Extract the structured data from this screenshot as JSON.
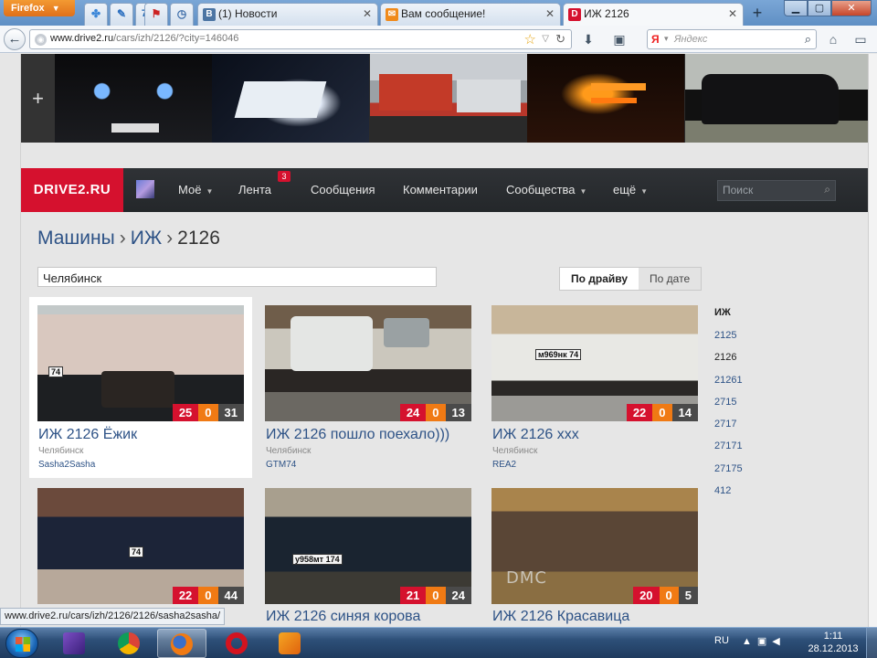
{
  "browser": {
    "app_button": "Firefox",
    "pinned_tabs": [
      {
        "icon": "google-icon",
        "label": ""
      },
      {
        "icon": "vk-icon",
        "label": ""
      },
      {
        "icon": "seventy-four-icon",
        "label": "74"
      },
      {
        "icon": "flag-icon",
        "label": ""
      },
      {
        "icon": "clock-icon",
        "label": ""
      }
    ],
    "tabs": [
      {
        "label": "(1) Новости",
        "favicon": "vk-icon",
        "favicon_text": "В",
        "color": "#4c75a3"
      },
      {
        "label": "Вам сообщение!",
        "favicon": "mail-icon",
        "favicon_text": "✉",
        "color": "#f08a1a"
      },
      {
        "label": "ИЖ 2126",
        "favicon": "drive2-icon",
        "favicon_text": "D",
        "color": "#d5112e"
      }
    ],
    "url_domain": "www.drive2.ru",
    "url_path": "/cars/izh/2126/?city=146046",
    "search_placeholder": "Яндекс"
  },
  "header": {
    "logo": "DRIVE2.RU",
    "nav": [
      {
        "label": "Моё",
        "dropdown": true
      },
      {
        "label": "Лента",
        "dropdown": false
      },
      {
        "label": "Сообщения",
        "dropdown": false
      },
      {
        "label": "Комментарии",
        "dropdown": false
      },
      {
        "label": "Сообщества",
        "dropdown": true
      },
      {
        "label": "ещё",
        "dropdown": true
      }
    ],
    "feed_badge": "3",
    "search_placeholder": "Поиск"
  },
  "breadcrumb": {
    "cars": "Машины",
    "brand": "ИЖ",
    "model": "2126",
    "separator": "›"
  },
  "filter": {
    "city": "Челябинск",
    "sort_options": [
      "По драйву",
      "По дате"
    ],
    "sort_selected": "По драйву"
  },
  "cars": [
    {
      "title": "ИЖ 2126 Ёжик",
      "city": "Челябинск",
      "user": "Sasha2Sasha",
      "likes": "25",
      "comments": "0",
      "photos": "31",
      "plate": "74"
    },
    {
      "title": "ИЖ 2126 пошло поехало)))",
      "city": "Челябинск",
      "user": "GTM74",
      "likes": "24",
      "comments": "0",
      "photos": "13",
      "plate": ""
    },
    {
      "title": "ИЖ 2126 xxx",
      "city": "Челябинск",
      "user": "REA2",
      "likes": "22",
      "comments": "0",
      "photos": "14",
      "plate": "м969нк 74"
    },
    {
      "title": "",
      "city": "",
      "user": "",
      "likes": "22",
      "comments": "0",
      "photos": "44",
      "plate": "74"
    },
    {
      "title": "ИЖ 2126 синяя корова",
      "city": "",
      "user": "",
      "likes": "21",
      "comments": "0",
      "photos": "24",
      "plate": "у958мт 174"
    },
    {
      "title": "ИЖ 2126 Красавица",
      "city": "",
      "user": "",
      "likes": "20",
      "comments": "0",
      "photos": "5",
      "plate": ""
    }
  ],
  "photo_watermark": "DMC",
  "models": {
    "heading": "ИЖ",
    "items": [
      "2125",
      "2126",
      "21261",
      "2715",
      "2717",
      "27171",
      "27175",
      "412"
    ],
    "selected": "2126"
  },
  "status_url": "www.drive2.ru/cars/izh/2126/2126/sasha2sasha/",
  "taskbar": {
    "apps": [
      "visual-studio-icon",
      "chrome-icon",
      "firefox-icon",
      "opera-icon",
      "qip-icon"
    ],
    "active_app": "firefox-icon",
    "language": "RU",
    "time": "1:11",
    "date": "28.12.2013"
  },
  "colors": {
    "brand_red": "#d5112e",
    "comment_orange": "#f07a14",
    "link_blue": "#2d5286",
    "header_dark": "#2a2d31"
  }
}
